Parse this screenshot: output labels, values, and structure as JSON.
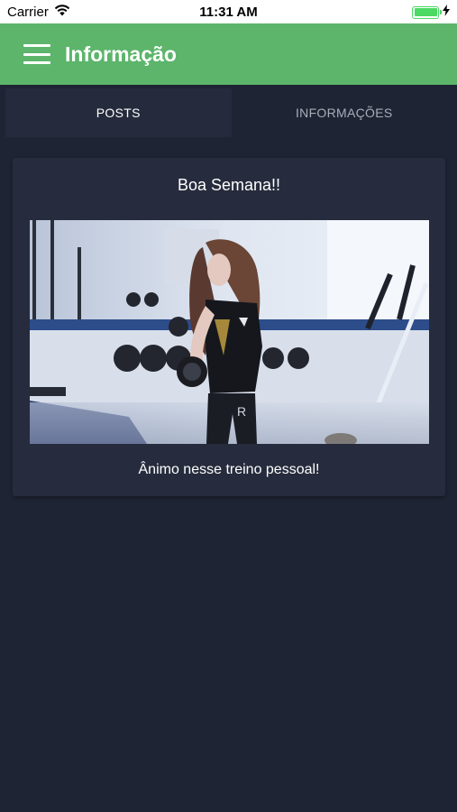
{
  "status_bar": {
    "carrier": "Carrier",
    "time": "11:31 AM",
    "battery_level": 1.0
  },
  "app_bar": {
    "title": "Informação",
    "menu_icon": "hamburger-menu-icon",
    "color": "#5cb56b"
  },
  "tabs": [
    {
      "label": "POSTS",
      "active": true
    },
    {
      "label": "INFORMAÇÕES",
      "active": false
    }
  ],
  "posts": [
    {
      "title": "Boa Semana!!",
      "image": "gym-woman-dumbbell-photo",
      "caption": "Ânimo nesse treino pessoal!"
    }
  ],
  "colors": {
    "background": "#1f2435",
    "card": "#262c3d",
    "accent": "#5cb56b"
  }
}
